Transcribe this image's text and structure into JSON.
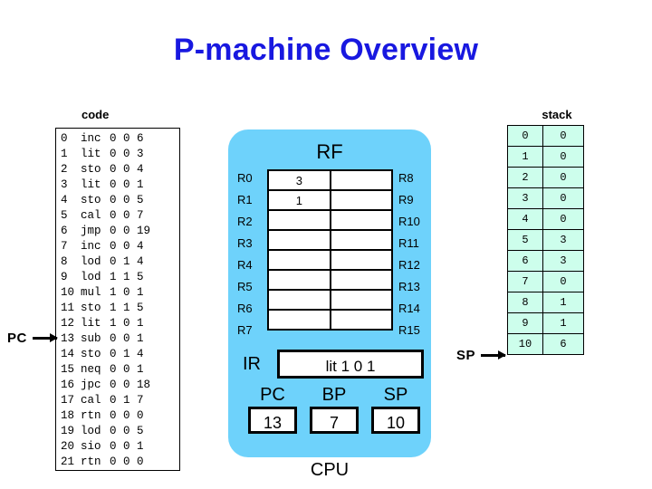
{
  "title": "P-machine Overview",
  "code": {
    "label": "code",
    "pointer": {
      "label": "PC",
      "target_address": 13
    },
    "instructions": [
      {
        "addr": "0",
        "op": "inc",
        "l": "0",
        "m": "0",
        "n": "6"
      },
      {
        "addr": "1",
        "op": "lit",
        "l": "0",
        "m": "0",
        "n": "3"
      },
      {
        "addr": "2",
        "op": "sto",
        "l": "0",
        "m": "0",
        "n": "4"
      },
      {
        "addr": "3",
        "op": "lit",
        "l": "0",
        "m": "0",
        "n": "1"
      },
      {
        "addr": "4",
        "op": "sto",
        "l": "0",
        "m": "0",
        "n": "5"
      },
      {
        "addr": "5",
        "op": "cal",
        "l": "0",
        "m": "0",
        "n": "7"
      },
      {
        "addr": "6",
        "op": "jmp",
        "l": "0",
        "m": "0",
        "n": "19"
      },
      {
        "addr": "7",
        "op": "inc",
        "l": "0",
        "m": "0",
        "n": "4"
      },
      {
        "addr": "8",
        "op": "lod",
        "l": "0",
        "m": "1",
        "n": "4"
      },
      {
        "addr": "9",
        "op": "lod",
        "l": "1",
        "m": "1",
        "n": "5"
      },
      {
        "addr": "10",
        "op": "mul",
        "l": "1",
        "m": "0",
        "n": "1"
      },
      {
        "addr": "11",
        "op": "sto",
        "l": "1",
        "m": "1",
        "n": "5"
      },
      {
        "addr": "12",
        "op": "lit",
        "l": "1",
        "m": "0",
        "n": "1"
      },
      {
        "addr": "13",
        "op": "sub",
        "l": "0",
        "m": "0",
        "n": "1"
      },
      {
        "addr": "14",
        "op": "sto",
        "l": "0",
        "m": "1",
        "n": "4"
      },
      {
        "addr": "15",
        "op": "neq",
        "l": "0",
        "m": "0",
        "n": "1"
      },
      {
        "addr": "16",
        "op": "jpc",
        "l": "0",
        "m": "0",
        "n": "18"
      },
      {
        "addr": "17",
        "op": "cal",
        "l": "0",
        "m": "1",
        "n": "7"
      },
      {
        "addr": "18",
        "op": "rtn",
        "l": "0",
        "m": "0",
        "n": "0"
      },
      {
        "addr": "19",
        "op": "lod",
        "l": "0",
        "m": "0",
        "n": "5"
      },
      {
        "addr": "20",
        "op": "sio",
        "l": "0",
        "m": "0",
        "n": "1"
      },
      {
        "addr": "21",
        "op": "rtn",
        "l": "0",
        "m": "0",
        "n": "0"
      }
    ]
  },
  "cpu": {
    "caption": "CPU",
    "rf": {
      "title": "RF",
      "left_names": [
        "R0",
        "R1",
        "R2",
        "R3",
        "R4",
        "R5",
        "R6",
        "R7"
      ],
      "right_names": [
        "R8",
        "R9",
        "R10",
        "R11",
        "R12",
        "R13",
        "R14",
        "R15"
      ],
      "left_values": [
        "3",
        "1",
        "",
        "",
        "",
        "",
        "",
        ""
      ],
      "right_values": [
        "",
        "",
        "",
        "",
        "",
        "",
        "",
        ""
      ]
    },
    "ir": {
      "label": "IR",
      "value": "lit 1 0 1"
    },
    "registers": [
      {
        "label": "PC",
        "value": "13"
      },
      {
        "label": "BP",
        "value": "7"
      },
      {
        "label": "SP",
        "value": "10"
      }
    ]
  },
  "stack": {
    "label": "stack",
    "pointer": {
      "label": "SP",
      "target_index": 10
    },
    "rows": [
      {
        "index": "0",
        "value": "0"
      },
      {
        "index": "1",
        "value": "0"
      },
      {
        "index": "2",
        "value": "0"
      },
      {
        "index": "3",
        "value": "0"
      },
      {
        "index": "4",
        "value": "0"
      },
      {
        "index": "5",
        "value": "3"
      },
      {
        "index": "6",
        "value": "3"
      },
      {
        "index": "7",
        "value": "0"
      },
      {
        "index": "8",
        "value": "1"
      },
      {
        "index": "9",
        "value": "1"
      },
      {
        "index": "10",
        "value": "6"
      }
    ]
  },
  "colors": {
    "title": "#1818e0",
    "cpu_fill": "#6ED2FB",
    "stack_fill": "#CDFEEC",
    "outline": "#000000"
  }
}
